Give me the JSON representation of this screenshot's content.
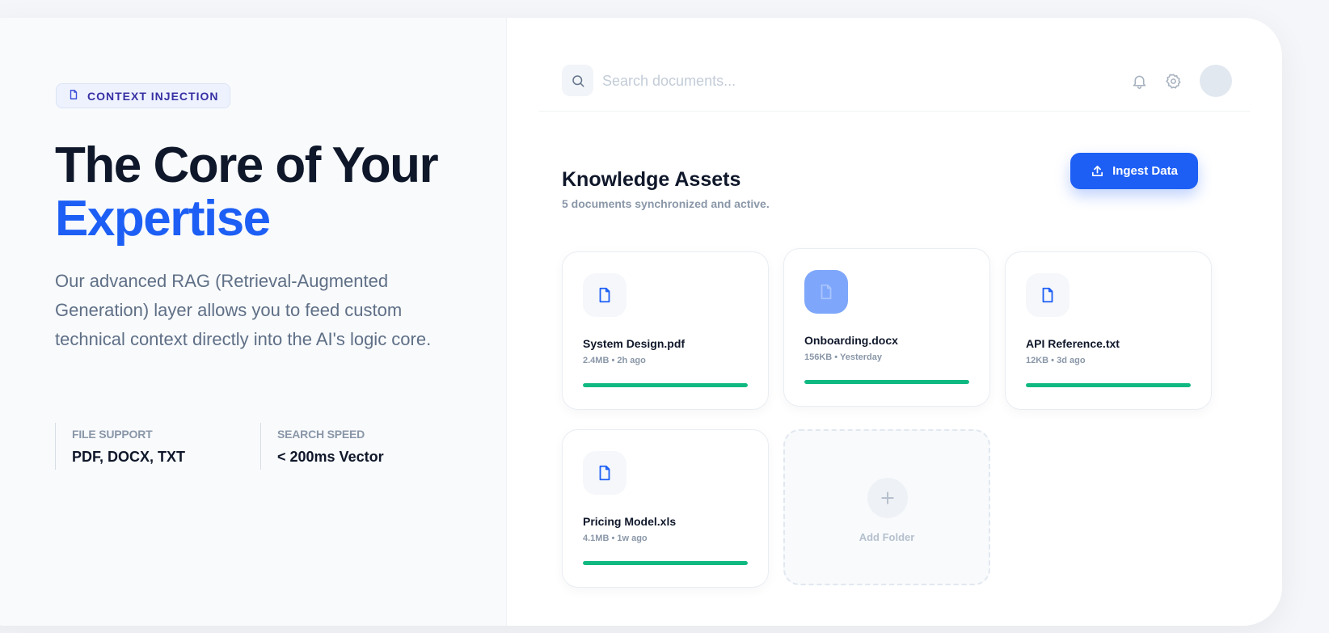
{
  "hero": {
    "badge": "CONTEXT INJECTION",
    "title_line1": "The Core of Your",
    "title_line2": "Expertise",
    "description": "Our advanced RAG (Retrieval-Augmented Generation) layer allows you to feed custom technical context directly into the AI's logic core.",
    "stats": [
      {
        "label": "FILE SUPPORT",
        "value": "PDF, DOCX, TXT"
      },
      {
        "label": "SEARCH SPEED",
        "value": "< 200ms Vector"
      }
    ]
  },
  "topbar": {
    "search_placeholder": "Search documents...",
    "search_value": ""
  },
  "assets": {
    "title": "Knowledge Assets",
    "subtitle": "5 documents synchronized and active.",
    "ingest_label": "Ingest Data",
    "add_folder_label": "Add Folder",
    "documents": [
      {
        "name": "System Design.pdf",
        "meta": "2.4MB • 2h ago",
        "progress": 1.0,
        "active": false
      },
      {
        "name": "Onboarding.docx",
        "meta": "156KB • Yesterday",
        "progress": 1.0,
        "active": true
      },
      {
        "name": "API Reference.txt",
        "meta": "12KB • 3d ago",
        "progress": 1.0,
        "active": false
      },
      {
        "name": "Pricing Model.xls",
        "meta": "4.1MB • 1w ago",
        "progress": 1.0,
        "active": false
      }
    ]
  },
  "colors": {
    "accent": "#1d5ff5",
    "progress": "#10b981",
    "text_primary": "#0f172a",
    "text_muted": "#8a97a8"
  },
  "icons": [
    "file-icon",
    "search-icon",
    "bell-icon",
    "gear-icon",
    "upload-icon",
    "plus-icon"
  ]
}
